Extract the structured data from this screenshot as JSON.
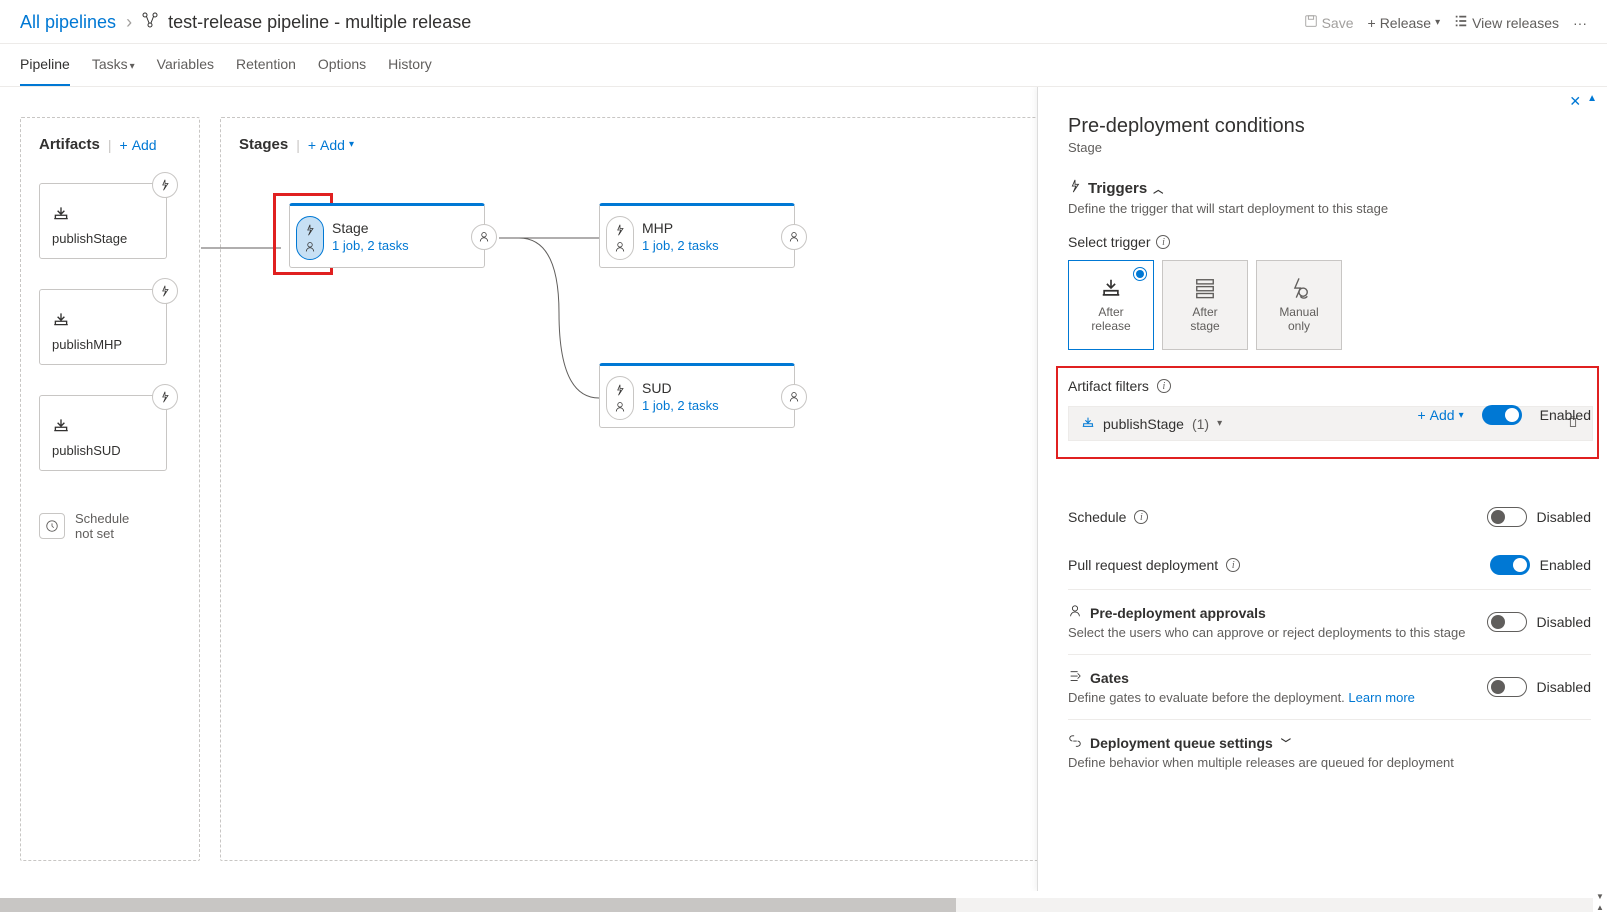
{
  "breadcrumb": {
    "root": "All pipelines",
    "title": "test-release pipeline - multiple release"
  },
  "topActions": {
    "save": "Save",
    "release": "Release",
    "viewReleases": "View releases"
  },
  "tabs": {
    "pipeline": "Pipeline",
    "tasks": "Tasks",
    "variables": "Variables",
    "retention": "Retention",
    "options": "Options",
    "history": "History"
  },
  "artifactsCol": {
    "title": "Artifacts",
    "add": "Add",
    "items": [
      {
        "name": "publishStage"
      },
      {
        "name": "publishMHP"
      },
      {
        "name": "publishSUD"
      }
    ],
    "schedule": "Schedule\nnot set"
  },
  "stagesCol": {
    "title": "Stages",
    "add": "Add",
    "items": [
      {
        "name": "Stage",
        "detail": "1 job, 2 tasks"
      },
      {
        "name": "MHP",
        "detail": "1 job, 2 tasks"
      },
      {
        "name": "SUD",
        "detail": "1 job, 2 tasks"
      }
    ]
  },
  "panel": {
    "title": "Pre-deployment conditions",
    "subtitle": "Stage",
    "triggers": {
      "head": "Triggers",
      "desc": "Define the trigger that will start deployment to this stage",
      "selectLabel": "Select trigger",
      "options": {
        "afterRelease": "After\nrelease",
        "afterStage": "After\nstage",
        "manualOnly": "Manual\nonly"
      }
    },
    "artifactFilters": {
      "label": "Artifact filters",
      "add": "Add",
      "state": "Enabled",
      "item": {
        "name": "publishStage",
        "count": "(1)"
      }
    },
    "schedule": {
      "label": "Schedule",
      "state": "Disabled"
    },
    "pullRequest": {
      "label": "Pull request deployment",
      "state": "Enabled"
    },
    "approvals": {
      "head": "Pre-deployment approvals",
      "desc": "Select the users who can approve or reject deployments to this stage",
      "state": "Disabled"
    },
    "gates": {
      "head": "Gates",
      "desc": "Define gates to evaluate before the deployment.",
      "learnMore": "Learn more",
      "state": "Disabled"
    },
    "queue": {
      "head": "Deployment queue settings",
      "desc": "Define behavior when multiple releases are queued for deployment"
    }
  }
}
